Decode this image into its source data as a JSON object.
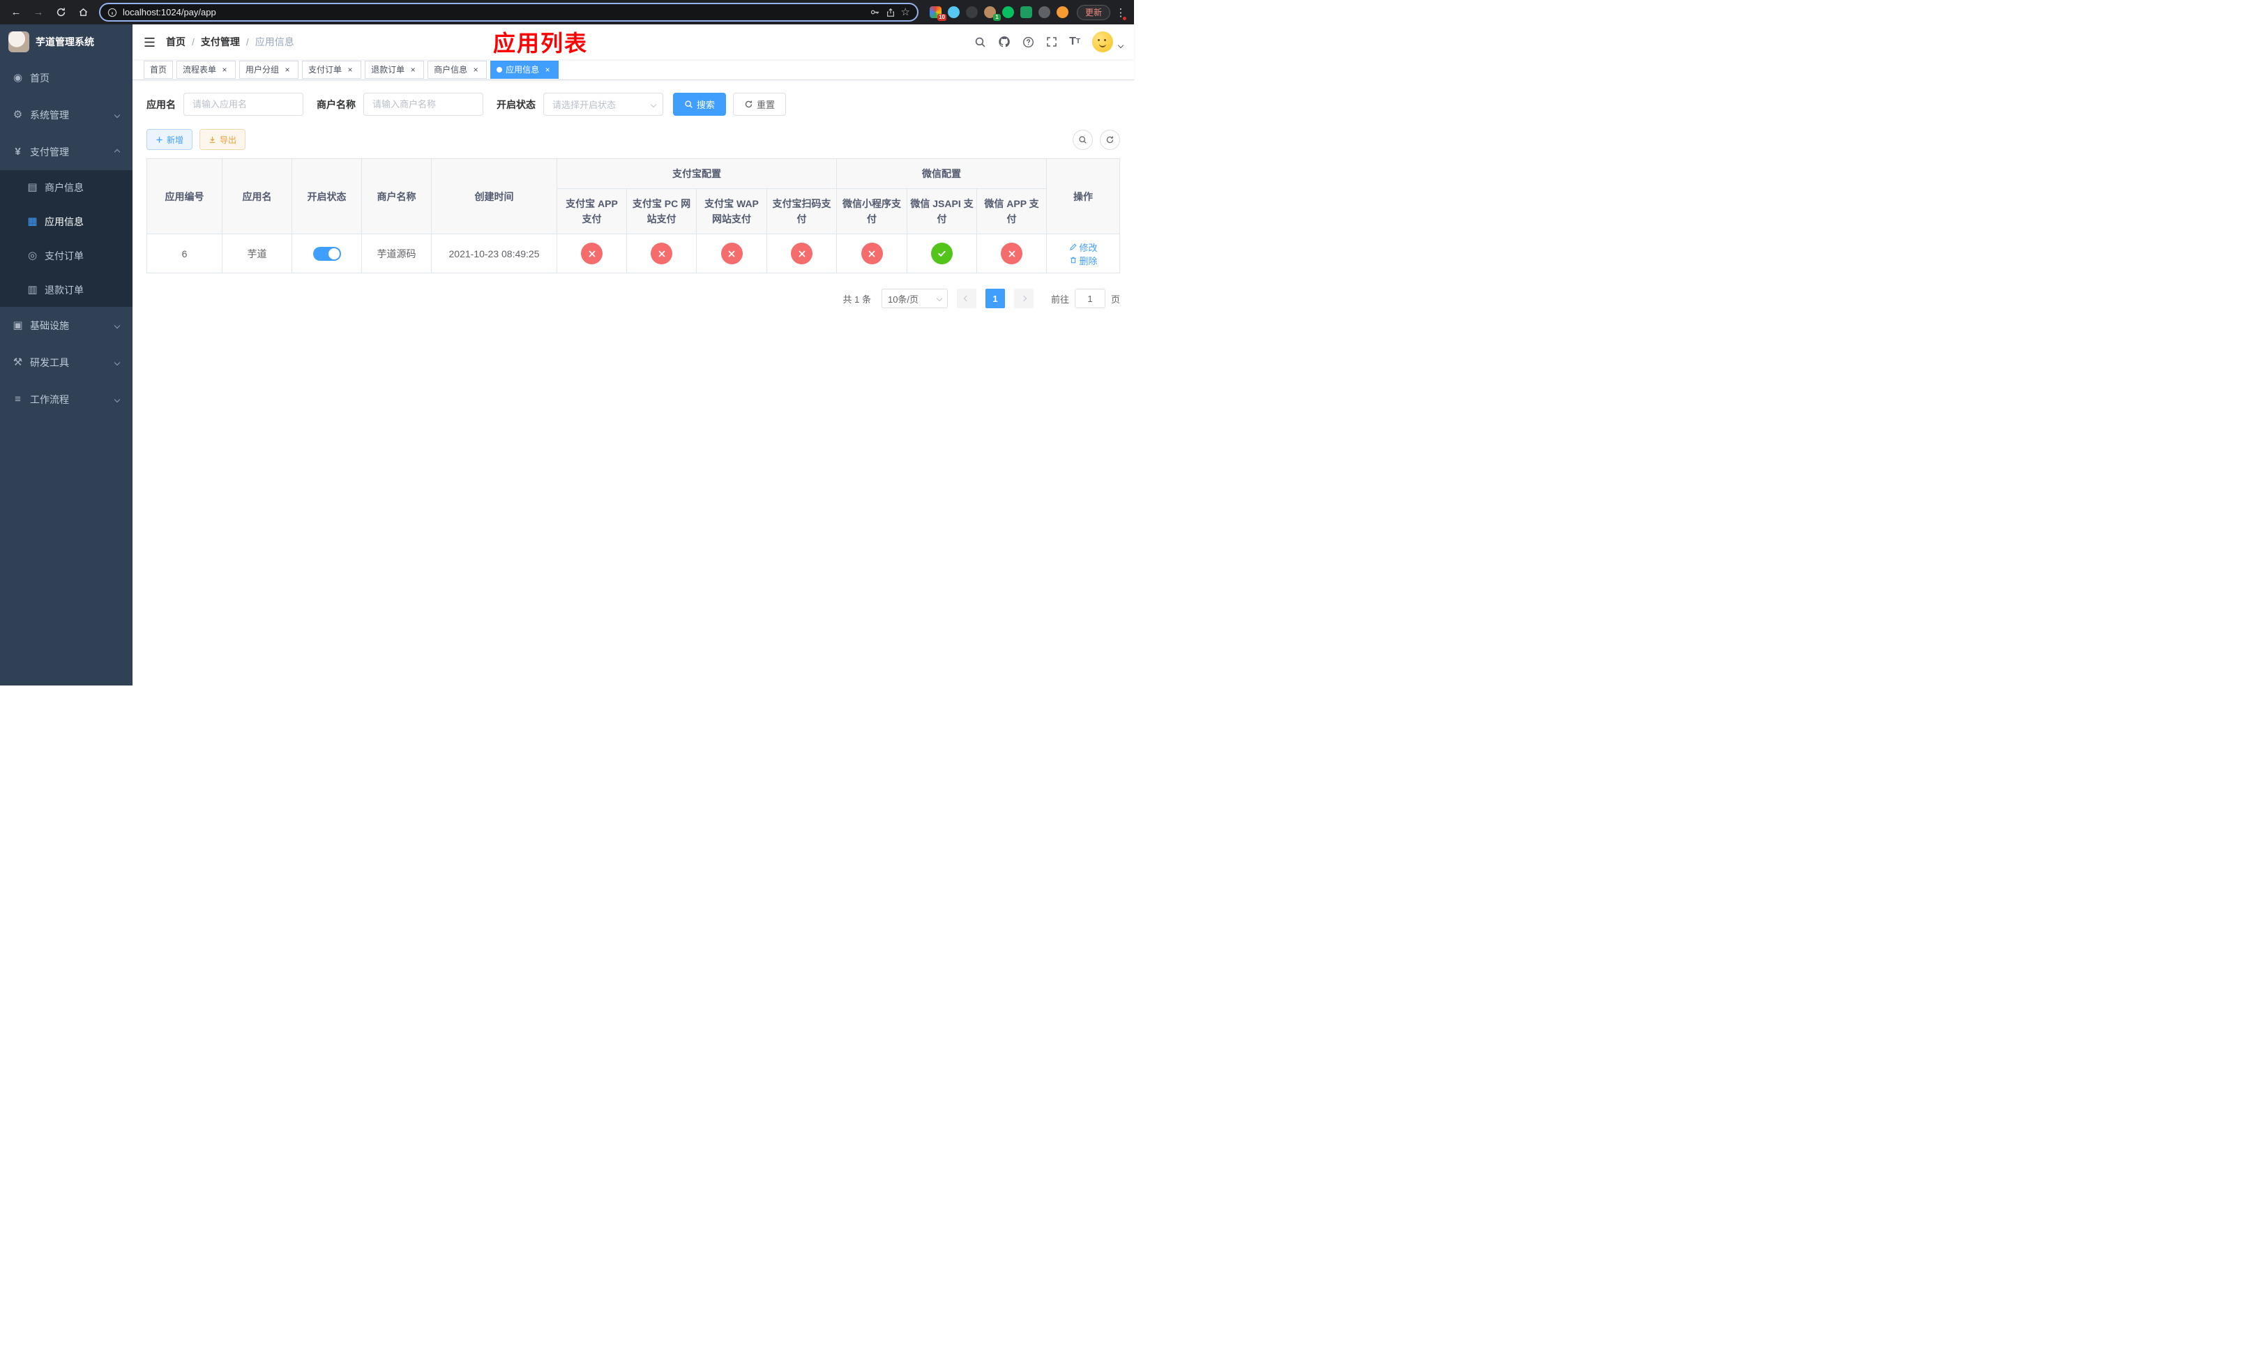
{
  "theme": {
    "primary": "#409EFF",
    "success": "#52C41A",
    "danger": "#F56C6C",
    "warning": "#E6A23C",
    "sidebar": "#304156",
    "submenu": "#1F2D3D",
    "title": "#FF0000"
  },
  "browser": {
    "url": "localhost:1024/pay/app",
    "update_label": "更新",
    "extensions_badge": "10",
    "profile_badge": "1"
  },
  "sidebar": {
    "title": "芋道管理系统",
    "items": [
      {
        "label": "首页"
      },
      {
        "label": "系统管理"
      },
      {
        "label": "支付管理"
      },
      {
        "label": "基础设施"
      },
      {
        "label": "研发工具"
      },
      {
        "label": "工作流程"
      }
    ],
    "pay_children": [
      {
        "label": "商户信息"
      },
      {
        "label": "应用信息"
      },
      {
        "label": "支付订单"
      },
      {
        "label": "退款订单"
      }
    ]
  },
  "navbar": {
    "breadcrumb": [
      "首页",
      "支付管理",
      "应用信息"
    ],
    "page_title": "应用列表"
  },
  "tabs": [
    {
      "label": "首页"
    },
    {
      "label": "流程表单"
    },
    {
      "label": "用户分组"
    },
    {
      "label": "支付订单"
    },
    {
      "label": "退款订单"
    },
    {
      "label": "商户信息"
    },
    {
      "label": "应用信息"
    }
  ],
  "filters": {
    "app_name_label": "应用名",
    "app_name_placeholder": "请输入应用名",
    "merchant_label": "商户名称",
    "merchant_placeholder": "请输入商户名称",
    "status_label": "开启状态",
    "status_placeholder": "请选择开启状态",
    "search_label": "搜索",
    "reset_label": "重置"
  },
  "toolbar": {
    "add_label": "新增",
    "export_label": "导出"
  },
  "table": {
    "groups": {
      "alipay": "支付宝配置",
      "wechat": "微信配置"
    },
    "columns": {
      "id": "应用编号",
      "name": "应用名",
      "status": "开启状态",
      "merchant": "商户名称",
      "created": "创建时间",
      "alipay_app": "支付宝 APP 支付",
      "alipay_pc": "支付宝 PC 网站支付",
      "alipay_wap": "支付宝 WAP 网站支付",
      "alipay_qr": "支付宝扫码支付",
      "wx_mini": "微信小程序支付",
      "wx_jsapi": "微信 JSAPI 支付",
      "wx_app": "微信 APP 支付",
      "actions": "操作"
    },
    "rows": [
      {
        "id": "6",
        "name": "芋道",
        "status": "on",
        "merchant": "芋道源码",
        "created": "2021-10-23 08:49:25",
        "alipay_app": "cross",
        "alipay_pc": "cross",
        "alipay_wap": "cross",
        "alipay_qr": "cross",
        "wx_mini": "cross",
        "wx_jsapi": "check",
        "wx_app": "cross",
        "edit_label": "修改",
        "delete_label": "删除"
      }
    ]
  },
  "pagination": {
    "total": "共 1 条",
    "page_size": "10条/页",
    "page": "1",
    "goto_label": "前往",
    "goto_value": "1",
    "unit_label": "页"
  }
}
